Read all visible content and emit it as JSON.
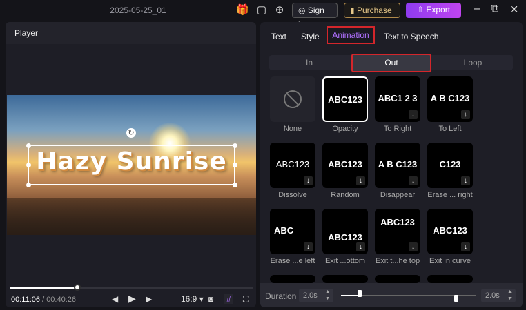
{
  "titlebar": {
    "title": "2025-05-25_01",
    "sign_in": "Sign in",
    "purchase": "Purchase",
    "export": "Export"
  },
  "player": {
    "header": "Player",
    "overlay_text": "Hazy Sunrise",
    "current_time": "00:11:06",
    "total_time": "/ 00:40:26",
    "aspect": "16:9",
    "progress": 0.27
  },
  "tabs": [
    "Text",
    "Style",
    "Animation",
    "Text to Speech"
  ],
  "segments": [
    "In",
    "Out",
    "Loop"
  ],
  "animations": [
    {
      "label": "None",
      "preview": ""
    },
    {
      "label": "Opacity",
      "preview": "ABC123"
    },
    {
      "label": "To Right",
      "preview": "ABC1 2 3"
    },
    {
      "label": "To Left",
      "preview": "A B C123"
    },
    {
      "label": "Dissolve",
      "preview": "ABC123"
    },
    {
      "label": "Random",
      "preview": "ABC123"
    },
    {
      "label": "Disappear",
      "preview": "A B C123"
    },
    {
      "label": "Erase ... right",
      "preview": "C123"
    },
    {
      "label": "Erase ...e left",
      "preview": "ABC"
    },
    {
      "label": "Exit ...ottom",
      "preview": "ABC123"
    },
    {
      "label": "Exit t...he top",
      "preview": "ABC123"
    },
    {
      "label": "Exit in curve",
      "preview": "ABC123"
    }
  ],
  "duration": {
    "label": "Duration",
    "in_value": "2.0s",
    "out_value": "2.0s"
  }
}
